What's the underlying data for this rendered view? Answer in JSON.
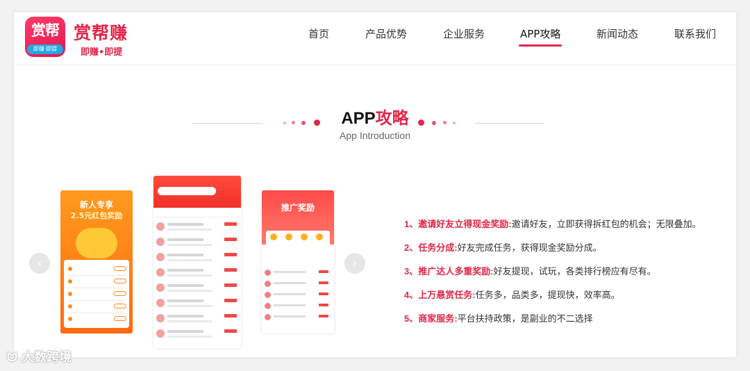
{
  "brand": {
    "logo_text": "赏帮",
    "logo_badge": "即赚·即提",
    "name": "赏帮赚",
    "slogan": "即赚•即提"
  },
  "nav": {
    "items": [
      {
        "label": "首页"
      },
      {
        "label": "产品优势"
      },
      {
        "label": "企业服务"
      },
      {
        "label": "APP攻略",
        "active": true
      },
      {
        "label": "新闻动态"
      },
      {
        "label": "联系我们"
      }
    ],
    "accent_color": "#e0284a"
  },
  "section": {
    "title_prefix": "APP",
    "title_highlight": "攻略",
    "subtitle": "App Introduction"
  },
  "phones": {
    "phone1": {
      "title": "新人专享",
      "subtitle": "2.5元红包奖励"
    },
    "phone3": {
      "banner": "推广奖励"
    }
  },
  "carousel": {
    "prev_icon": "chevron-left-icon",
    "next_icon": "chevron-right-icon"
  },
  "features": [
    {
      "key": "1、邀请好友立得现金奖励:",
      "text": "邀请好友，立即获得拆红包的机会；无限叠加。"
    },
    {
      "key": "2、任务分成:",
      "text": "好友完成任务，获得现金奖励分成。"
    },
    {
      "key": "3、推广达人多重奖励:",
      "text": "好友提现，试玩，各类排行榜应有尽有。"
    },
    {
      "key": "4、上万悬赏任务:",
      "text": "任务多，品类多，提现快，效率高。"
    },
    {
      "key": "5、商家服务:",
      "text": "平台扶持政策，是副业的不二选择"
    }
  ],
  "watermark": "大数跨境"
}
